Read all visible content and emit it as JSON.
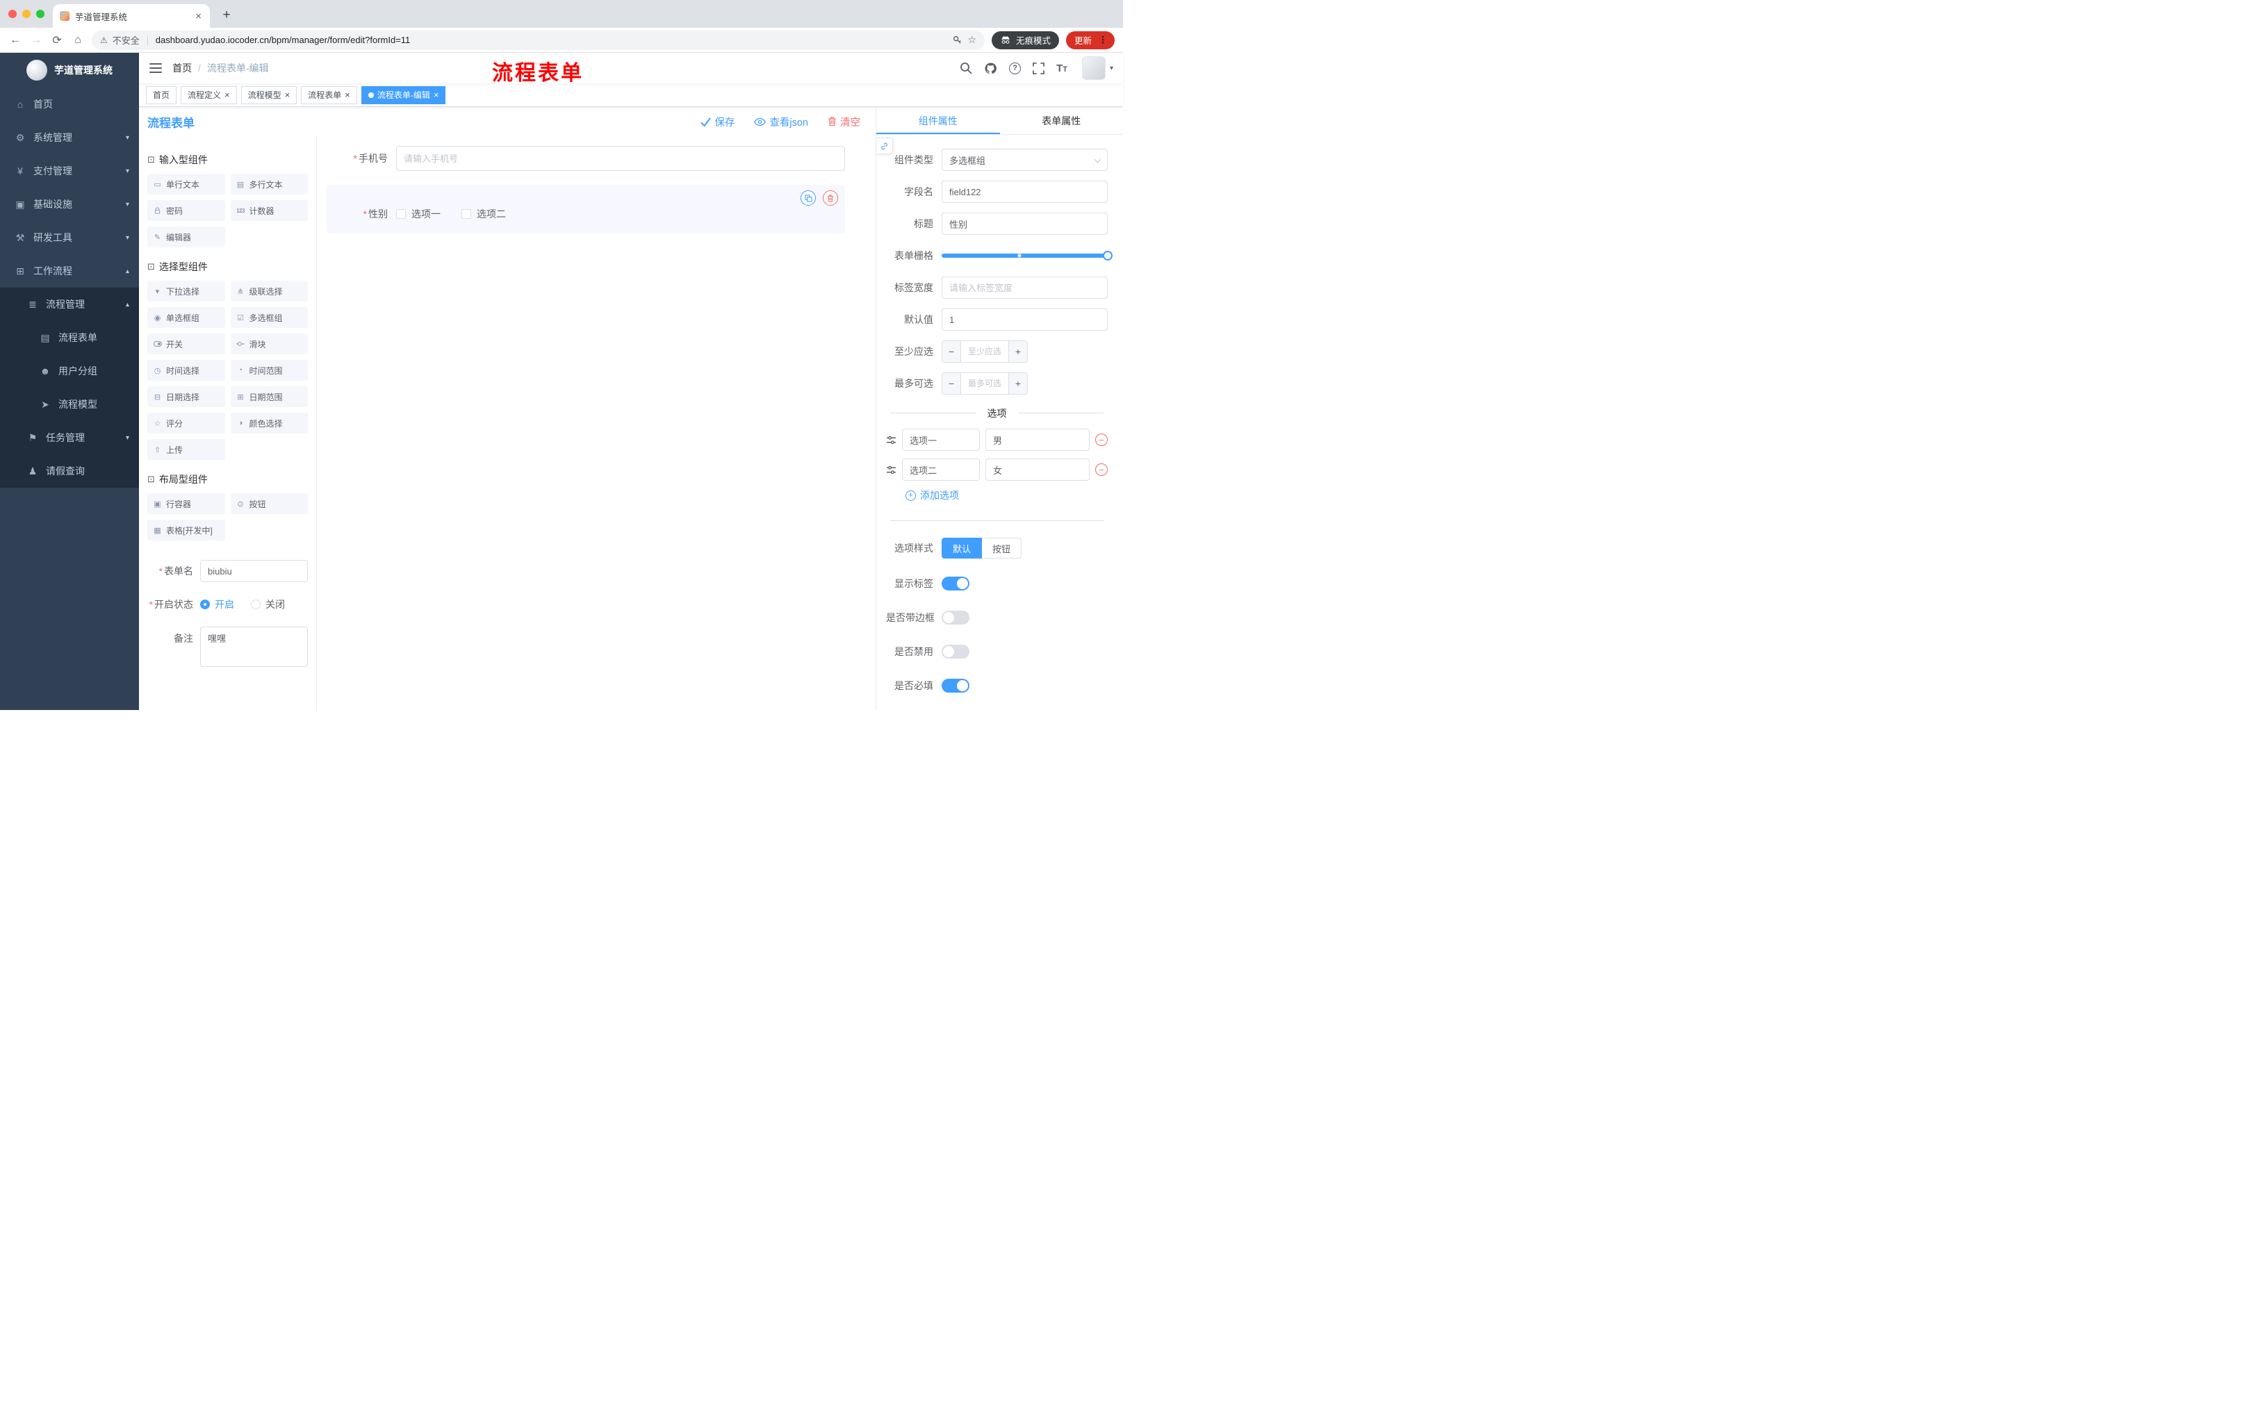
{
  "chrome": {
    "tab_title": "芋道管理系统",
    "security_label": "不安全",
    "url": "dashboard.yudao.iocoder.cn/bpm/manager/form/edit?formId=11",
    "incognito_label": "无痕模式",
    "update_label": "更新"
  },
  "marks": {
    "required": "*"
  },
  "sidebar": {
    "logo_title": "芋道管理系统",
    "items": [
      {
        "label": "首页",
        "icon": "home-icon"
      },
      {
        "label": "系统管理",
        "icon": "gear-icon"
      },
      {
        "label": "支付管理",
        "icon": "payment-icon"
      },
      {
        "label": "基础设施",
        "icon": "infrastructure-icon"
      },
      {
        "label": "研发工具",
        "icon": "dev-tools-icon"
      },
      {
        "label": "工作流程",
        "icon": "workflow-icon"
      },
      {
        "label": "流程管理",
        "icon": "process-management-icon"
      },
      {
        "label": "流程表单",
        "icon": "process-form-icon"
      },
      {
        "label": "用户分组",
        "icon": "user-group-icon"
      },
      {
        "label": "流程模型",
        "icon": "process-model-icon"
      },
      {
        "label": "任务管理",
        "icon": "task-management-icon"
      },
      {
        "label": "请假查询",
        "icon": "leave-query-icon"
      }
    ]
  },
  "header": {
    "breadcrumb_home": "首页",
    "breadcrumb_current": "流程表单-编辑",
    "watermark": "流程表单"
  },
  "tags": [
    {
      "label": "首页"
    },
    {
      "label": "流程定义"
    },
    {
      "label": "流程模型"
    },
    {
      "label": "流程表单"
    },
    {
      "label": "流程表单-编辑"
    }
  ],
  "designer": {
    "panel_title": "流程表单",
    "actions": {
      "save": "保存",
      "view_json": "查看json",
      "clear": "清空"
    },
    "palette": {
      "input_title": "输入型组件",
      "input_items": [
        "单行文本",
        "多行文本",
        "密码",
        "计数器",
        "编辑器"
      ],
      "select_title": "选择型组件",
      "select_items": [
        "下拉选择",
        "级联选择",
        "单选框组",
        "多选框组",
        "开关",
        "滑块",
        "时间选择",
        "时间范围",
        "日期选择",
        "日期范围",
        "评分",
        "颜色选择",
        "上传"
      ],
      "layout_title": "布局型组件",
      "layout_items": [
        "行容器",
        "按钮",
        "表格[开发中]"
      ]
    },
    "meta": {
      "name_label": "表单名",
      "name_value": "biubiu",
      "status_label": "开启状态",
      "status_on": "开启",
      "status_off": "关闭",
      "remark_label": "备注",
      "remark_value": "嘿嘿"
    },
    "canvas": {
      "phone_label": "手机号",
      "phone_placeholder": "请输入手机号",
      "gender_label": "性别",
      "gender_opt1": "选项一",
      "gender_opt2": "选项二"
    }
  },
  "props": {
    "tab_component": "组件属性",
    "tab_form": "表单属性",
    "type_label": "组件类型",
    "type_value": "多选框组",
    "field_label": "字段名",
    "field_value": "field122",
    "title_label": "标题",
    "title_value": "性别",
    "grid_label": "表单栅格",
    "label_width_label": "标签宽度",
    "label_width_placeholder": "请输入标签宽度",
    "default_label": "默认值",
    "default_value": "1",
    "min_label": "至少应选",
    "min_placeholder": "至少应选",
    "max_label": "最多可选",
    "max_placeholder": "最多可选",
    "options_title": "选项",
    "options": [
      {
        "label": "选项一",
        "value": "男"
      },
      {
        "label": "选项二",
        "value": "女"
      }
    ],
    "add_option": "添加选项",
    "style_label": "选项样式",
    "style_default": "默认",
    "style_button": "按钮",
    "switches": {
      "show_label": "显示标签",
      "border": "是否带边框",
      "disabled": "是否禁用",
      "required": "是否必填"
    },
    "colors": {
      "accent": "#409eff",
      "danger": "#f56c6c"
    }
  }
}
